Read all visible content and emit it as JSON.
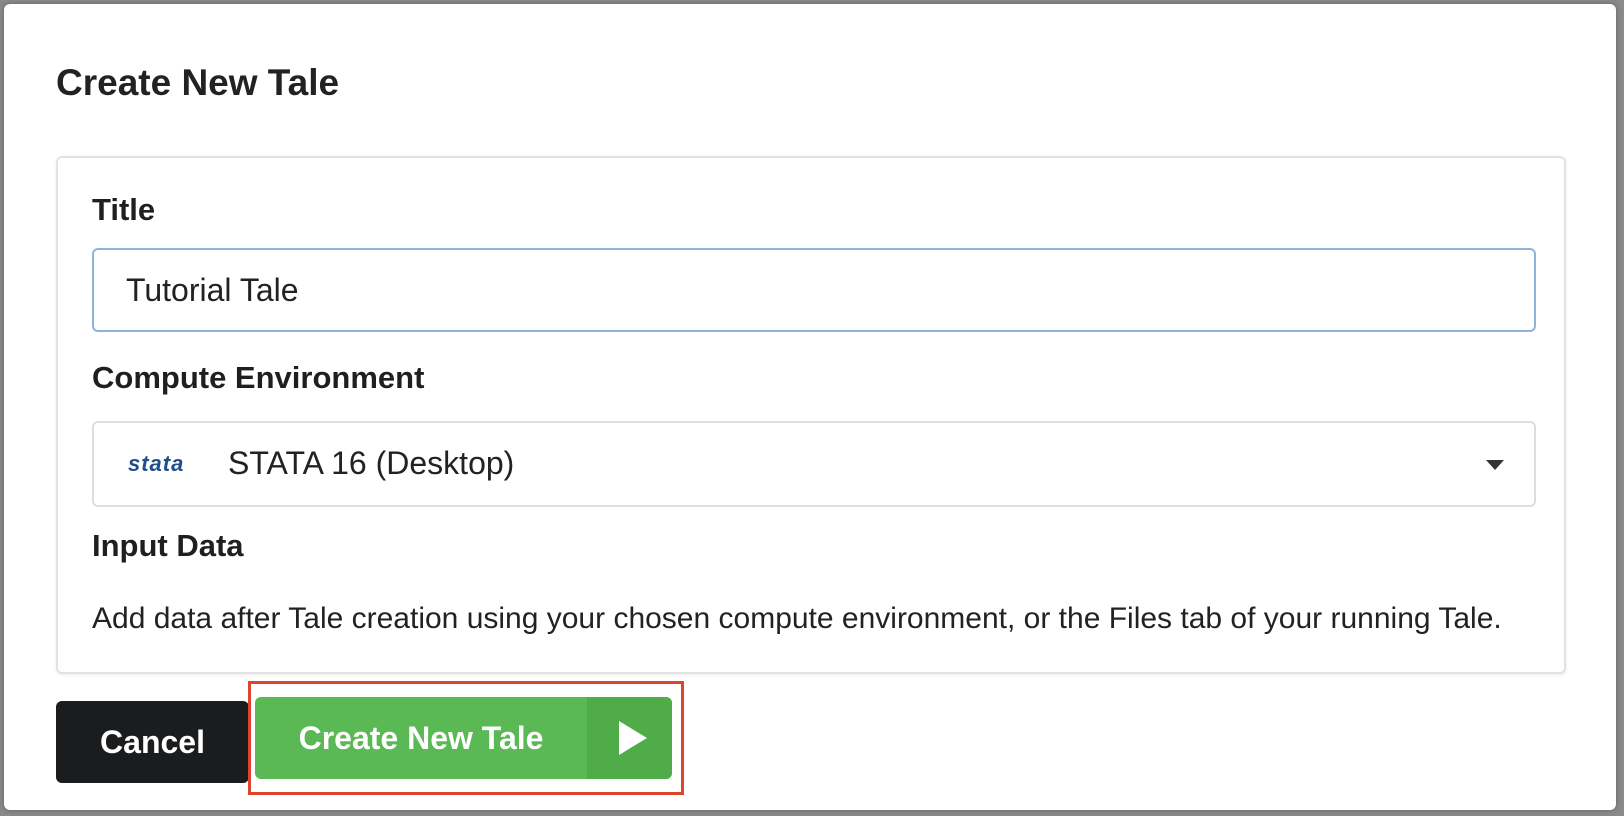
{
  "modal": {
    "title": "Create New Tale"
  },
  "form": {
    "title_label": "Title",
    "title_value": "Tutorial Tale",
    "environment_label": "Compute Environment",
    "environment_logo": "stata",
    "environment_value": "STATA 16 (Desktop)",
    "input_data_label": "Input Data",
    "input_data_help": "Add data after Tale creation using your chosen compute environment, or the Files tab of your running Tale."
  },
  "actions": {
    "cancel_label": "Cancel",
    "create_label": "Create New Tale",
    "create_icon": "play-icon"
  },
  "colors": {
    "create_button": "#5ab954",
    "cancel_button": "#1b1c1d",
    "highlight": "#e0432d",
    "input_focus_border": "#8fb3d9"
  }
}
